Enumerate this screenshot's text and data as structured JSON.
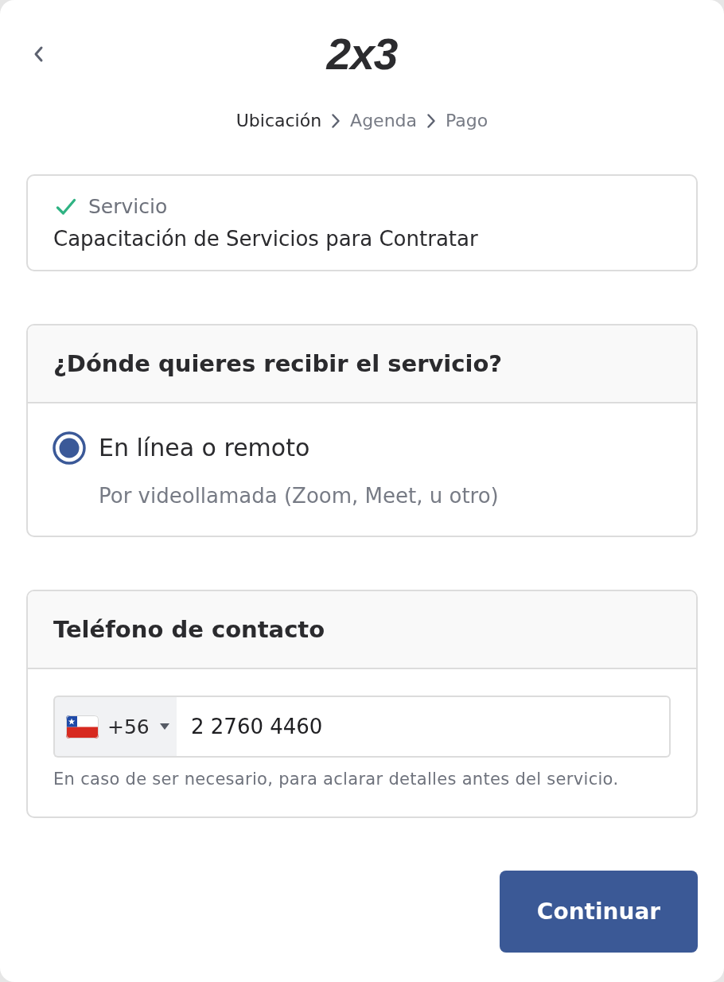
{
  "header": {
    "logo": "2x3"
  },
  "breadcrumb": [
    {
      "label": "Ubicación",
      "selected": true
    },
    {
      "label": "Agenda",
      "selected": false
    },
    {
      "label": "Pago",
      "selected": false
    }
  ],
  "service_card": {
    "completed": true,
    "label": "Servicio",
    "value": "Capacitación de Servicios para Contratar"
  },
  "location_section": {
    "title": "¿Dónde quieres recibir el servicio?",
    "options": [
      {
        "label": "En línea o remoto",
        "description": "Por videollamada (Zoom, Meet, u otro)",
        "selected": true
      }
    ]
  },
  "phone_section": {
    "title": "Teléfono de contacto",
    "country_code": "+56",
    "value": "2 2760 4460",
    "helper": "En caso de ser necesario, para aclarar detalles antes del servicio."
  },
  "buttons": [
    {
      "label": "Continuar"
    }
  ]
}
